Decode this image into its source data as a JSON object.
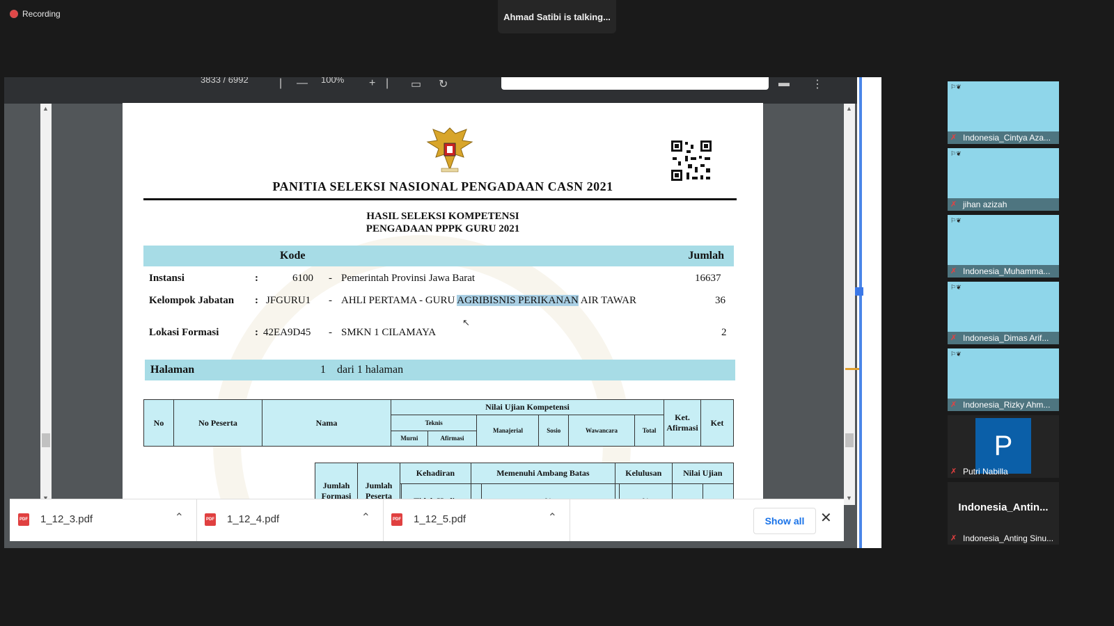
{
  "recording": {
    "label": "Recording"
  },
  "talking": {
    "text": "Ahmad Satibi is talking..."
  },
  "pdf_toolbar": {
    "page_indicator": "3833 / 6992",
    "zoom": "100%"
  },
  "document": {
    "title": "PANITIA SELEKSI NASIONAL PENGADAAN CASN 2021",
    "subtitle1": "HASIL SELEKSI KOMPETENSI",
    "subtitle2": "PENGADAAN PPPK GURU 2021",
    "header_kode": "Kode",
    "header_jumlah": "Jumlah",
    "instansi": {
      "label": "Instansi",
      "colon": ":",
      "code": "6100",
      "dash": "-",
      "name": "Pemerintah Provinsi Jawa Barat",
      "count": "16637"
    },
    "kelompok": {
      "label": "Kelompok Jabatan",
      "colon": ":",
      "code": "JFGURU1",
      "dash": "-",
      "name_pre": "AHLI PERTAMA - GURU ",
      "name_hl": "AGRIBISNIS PERIKANAN",
      "name_post": " AIR TAWAR",
      "count": "36"
    },
    "lokasi": {
      "label": "Lokasi Formasi",
      "colon": ":",
      "code": "42EA9D45",
      "dash": "-",
      "name": "SMKN 1 CILAMAYA",
      "count": "2"
    },
    "halaman": {
      "label": "Halaman",
      "num": "1",
      "text": "dari 1 halaman"
    },
    "table1": {
      "no": "No",
      "no_peserta": "No Peserta",
      "nama": "Nama",
      "nilai_ujian": "Nilai Ujian Kompetensi",
      "teknis": "Teknis",
      "murni": "Murni",
      "afirmasi": "Afirmasi",
      "manajerial": "Manajerial",
      "sosio": "Sosio",
      "wawancara": "Wawancara",
      "total": "Total",
      "ket_afirmasi": "Ket. Afirmasi",
      "ket": "Ket"
    },
    "table2": {
      "jumlah_formasi": "Jumlah Formasi",
      "jumlah_peserta": "Jumlah Peserta",
      "kehadiran": "Kehadiran",
      "tidak_hadir": "Tidak Hadir",
      "memenuhi": "Memenuhi Ambang Batas",
      "kelulusan": "Kelulusan",
      "pct": "%",
      "nilai_ujian": "Nilai Ujian"
    }
  },
  "downloads": {
    "items": [
      {
        "name": "1_12_3.pdf",
        "icon": "pdf-file-icon"
      },
      {
        "name": "1_12_4.pdf",
        "icon": "pdf-file-icon"
      },
      {
        "name": "1_12_5.pdf",
        "icon": "pdf-file-icon"
      }
    ],
    "show_all": "Show all"
  },
  "participants": [
    {
      "name": "Indonesia_Cintya Aza..."
    },
    {
      "name": "jihan azizah"
    },
    {
      "name": "Indonesia_Muhamma..."
    },
    {
      "name": "Indonesia_Dimas Arif..."
    },
    {
      "name": "Indonesia_Rizky Ahm..."
    },
    {
      "name": "Putri Nabilla",
      "avatar_letter": "P"
    },
    {
      "name": "Indonesia_Anting Sinu...",
      "display": "Indonesia_Antin..."
    }
  ],
  "colors": {
    "band": "#a7dce6",
    "table_header": "#c7eef5",
    "accent_blue": "#1a73e8",
    "avatar_blue": "#0b5fa8"
  }
}
